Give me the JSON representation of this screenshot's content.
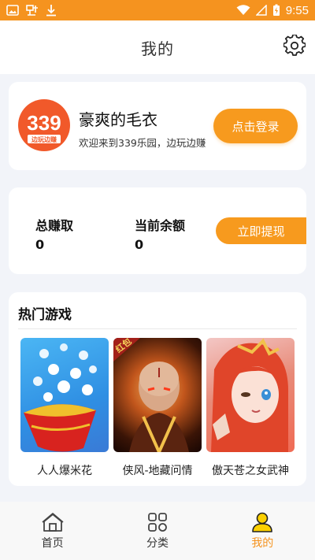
{
  "status_bar": {
    "time": "9:55",
    "background_color": "#f5931f"
  },
  "header": {
    "title": "我的"
  },
  "profile": {
    "logo_text": "339",
    "logo_sub_text": "边玩边赚",
    "username": "豪爽的毛衣",
    "welcome": "欢迎来到339乐园，边玩边赚",
    "login_label": "点击登录"
  },
  "earnings": {
    "total_label": "总赚取",
    "total_value": "0",
    "balance_label": "当前余额",
    "balance_value": "0",
    "withdraw_label": "立即提现"
  },
  "games": {
    "title": "热门游戏",
    "items": [
      {
        "name": "人人爆米花",
        "icon": "popcorn-game-cover"
      },
      {
        "name": "侠风-地藏问情",
        "icon": "monk-game-cover",
        "badge": "红包"
      },
      {
        "name": "傲天苍之女武神",
        "icon": "anime-girl-game-cover"
      }
    ]
  },
  "tabs": [
    {
      "label": "首页",
      "icon": "home-icon",
      "active": false
    },
    {
      "label": "分类",
      "icon": "category-icon",
      "active": false
    },
    {
      "label": "我的",
      "icon": "profile-icon",
      "active": true
    }
  ],
  "colors": {
    "accent": "#f79a1e",
    "page_bg": "#f2f4f9"
  }
}
